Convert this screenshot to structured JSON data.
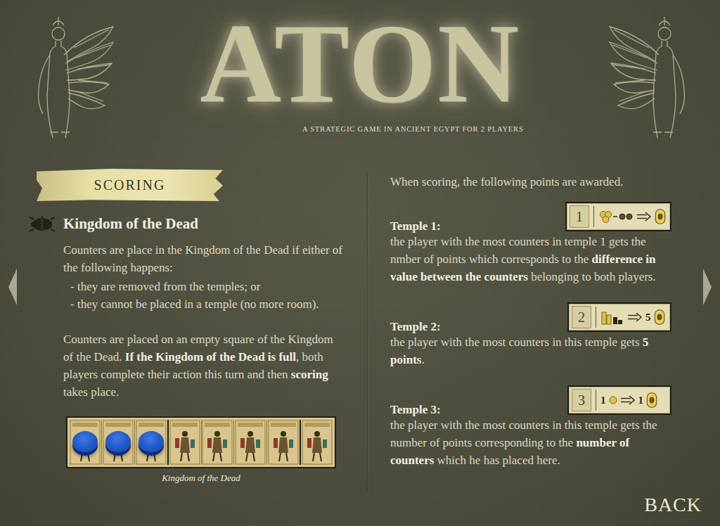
{
  "header": {
    "title": "ATON",
    "subtitle": "A STRATEGIC GAME IN ANCIENT EGYPT FOR 2 PLAYERS"
  },
  "section_tag": "SCORING",
  "kingdom": {
    "heading": "Kingdom of the Dead",
    "intro": "Counters are place in the Kingdom of the Dead if either of the following happens:",
    "conditions": [
      "- they are removed from the temples; or",
      "- they cannot be placed in a temple (no more room)."
    ],
    "rule": [
      {
        "text": "Counters are placed on an empty square of the Kingdom of the Dead. ",
        "bold": false
      },
      {
        "text": "If the Kingdom of the Dead is full",
        "bold": true
      },
      {
        "text": ", both players complete their action this turn and then ",
        "bold": false
      },
      {
        "text": "scoring",
        "bold": true
      },
      {
        "text": " takes place.",
        "bold": false
      }
    ],
    "board": {
      "squares": [
        {
          "occupied": true
        },
        {
          "occupied": true
        },
        {
          "occupied": true
        },
        {
          "occupied": false
        },
        {
          "occupied": false
        },
        {
          "occupied": false
        },
        {
          "occupied": false
        },
        {
          "occupied": false
        }
      ],
      "caption": "Kingdom of the Dead"
    }
  },
  "scoring": {
    "intro": "When scoring, the following points are awarded.",
    "temples": [
      {
        "title": "Temple 1:",
        "tile": {
          "kind": "difference",
          "number": "1",
          "condition": null,
          "reward": null
        },
        "description": [
          {
            "text": "the player with the most counters in temple 1 gets the nmber of points which corresponds to the ",
            "bold": false
          },
          {
            "text": "difference in value between the counters",
            "bold": true
          },
          {
            "text": " belonging to both players.",
            "bold": false
          }
        ]
      },
      {
        "title": "Temple 2:",
        "tile": {
          "kind": "majority",
          "number": "2",
          "condition": null,
          "reward": "5"
        },
        "description": [
          {
            "text": "the player with the most counters in this temple gets ",
            "bold": false
          },
          {
            "text": "5 points",
            "bold": true
          },
          {
            "text": ".",
            "bold": false
          }
        ]
      },
      {
        "title": "Temple 3:",
        "tile": {
          "kind": "count",
          "number": "3",
          "condition": "1",
          "reward": "1"
        },
        "description": [
          {
            "text": "the player with the most counters in this temple gets the number of points corresponding to the ",
            "bold": false
          },
          {
            "text": "number of counters",
            "bold": true
          },
          {
            "text": " which he has placed here.",
            "bold": false
          }
        ]
      }
    ]
  },
  "navigation": {
    "back": "BACK"
  }
}
